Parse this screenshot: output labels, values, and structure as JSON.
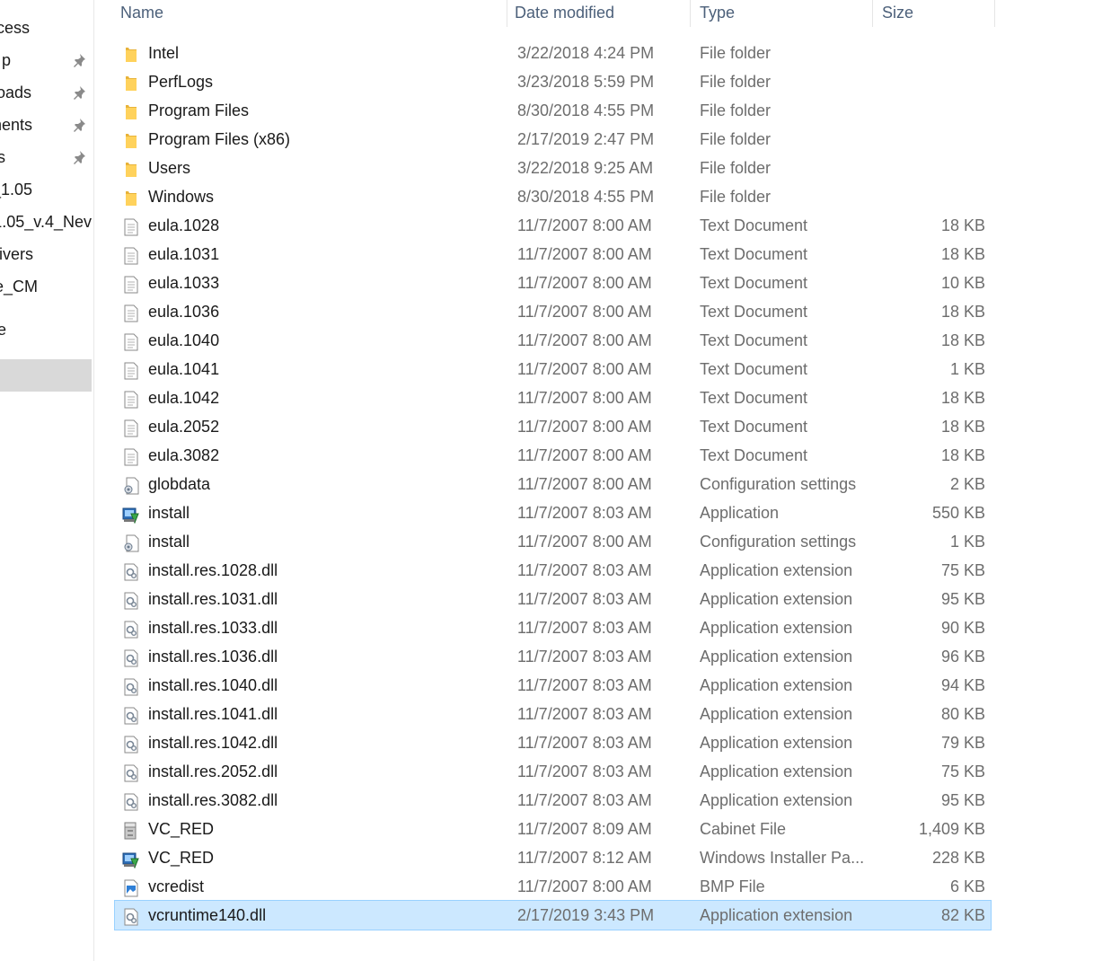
{
  "nav": {
    "items": [
      {
        "label": "cess",
        "pinned": false,
        "selected": false
      },
      {
        "label": "p",
        "pinned": true,
        "selected": false
      },
      {
        "label": "oads",
        "pinned": true,
        "selected": false
      },
      {
        "label": "nents",
        "pinned": true,
        "selected": false
      },
      {
        "label": "s",
        "pinned": true,
        "selected": false
      },
      {
        "label": "_1.05",
        "pinned": false,
        "selected": false
      },
      {
        "label": "_1.05_v.4_Nev",
        "pinned": false,
        "selected": false
      },
      {
        "label": "ivers",
        "pinned": false,
        "selected": false
      },
      {
        "label": "e_CM",
        "pinned": false,
        "selected": false
      },
      {
        "label": "e",
        "pinned": false,
        "selected": false
      },
      {
        "label": "",
        "pinned": false,
        "selected": true
      }
    ]
  },
  "columns": {
    "name": "Name",
    "date": "Date modified",
    "type": "Type",
    "size": "Size"
  },
  "files": [
    {
      "name": "Intel",
      "date": "3/22/2018 4:24 PM",
      "type": "File folder",
      "size": "",
      "icon": "folder-icon"
    },
    {
      "name": "PerfLogs",
      "date": "3/23/2018 5:59 PM",
      "type": "File folder",
      "size": "",
      "icon": "folder-icon"
    },
    {
      "name": "Program Files",
      "date": "8/30/2018 4:55 PM",
      "type": "File folder",
      "size": "",
      "icon": "folder-icon"
    },
    {
      "name": "Program Files (x86)",
      "date": "2/17/2019 2:47 PM",
      "type": "File folder",
      "size": "",
      "icon": "folder-icon"
    },
    {
      "name": "Users",
      "date": "3/22/2018 9:25 AM",
      "type": "File folder",
      "size": "",
      "icon": "folder-icon"
    },
    {
      "name": "Windows",
      "date": "8/30/2018 4:55 PM",
      "type": "File folder",
      "size": "",
      "icon": "folder-icon"
    },
    {
      "name": "eula.1028",
      "date": "11/7/2007 8:00 AM",
      "type": "Text Document",
      "size": "18 KB",
      "icon": "text-document-icon"
    },
    {
      "name": "eula.1031",
      "date": "11/7/2007 8:00 AM",
      "type": "Text Document",
      "size": "18 KB",
      "icon": "text-document-icon"
    },
    {
      "name": "eula.1033",
      "date": "11/7/2007 8:00 AM",
      "type": "Text Document",
      "size": "10 KB",
      "icon": "text-document-icon"
    },
    {
      "name": "eula.1036",
      "date": "11/7/2007 8:00 AM",
      "type": "Text Document",
      "size": "18 KB",
      "icon": "text-document-icon"
    },
    {
      "name": "eula.1040",
      "date": "11/7/2007 8:00 AM",
      "type": "Text Document",
      "size": "18 KB",
      "icon": "text-document-icon"
    },
    {
      "name": "eula.1041",
      "date": "11/7/2007 8:00 AM",
      "type": "Text Document",
      "size": "1 KB",
      "icon": "text-document-icon"
    },
    {
      "name": "eula.1042",
      "date": "11/7/2007 8:00 AM",
      "type": "Text Document",
      "size": "18 KB",
      "icon": "text-document-icon"
    },
    {
      "name": "eula.2052",
      "date": "11/7/2007 8:00 AM",
      "type": "Text Document",
      "size": "18 KB",
      "icon": "text-document-icon"
    },
    {
      "name": "eula.3082",
      "date": "11/7/2007 8:00 AM",
      "type": "Text Document",
      "size": "18 KB",
      "icon": "text-document-icon"
    },
    {
      "name": "globdata",
      "date": "11/7/2007 8:00 AM",
      "type": "Configuration settings",
      "size": "2 KB",
      "icon": "config-settings-icon"
    },
    {
      "name": "install",
      "date": "11/7/2007 8:03 AM",
      "type": "Application",
      "size": "550 KB",
      "icon": "installer-application-icon"
    },
    {
      "name": "install",
      "date": "11/7/2007 8:00 AM",
      "type": "Configuration settings",
      "size": "1 KB",
      "icon": "config-settings-icon"
    },
    {
      "name": "install.res.1028.dll",
      "date": "11/7/2007 8:03 AM",
      "type": "Application extension",
      "size": "75 KB",
      "icon": "dll-file-icon"
    },
    {
      "name": "install.res.1031.dll",
      "date": "11/7/2007 8:03 AM",
      "type": "Application extension",
      "size": "95 KB",
      "icon": "dll-file-icon"
    },
    {
      "name": "install.res.1033.dll",
      "date": "11/7/2007 8:03 AM",
      "type": "Application extension",
      "size": "90 KB",
      "icon": "dll-file-icon"
    },
    {
      "name": "install.res.1036.dll",
      "date": "11/7/2007 8:03 AM",
      "type": "Application extension",
      "size": "96 KB",
      "icon": "dll-file-icon"
    },
    {
      "name": "install.res.1040.dll",
      "date": "11/7/2007 8:03 AM",
      "type": "Application extension",
      "size": "94 KB",
      "icon": "dll-file-icon"
    },
    {
      "name": "install.res.1041.dll",
      "date": "11/7/2007 8:03 AM",
      "type": "Application extension",
      "size": "80 KB",
      "icon": "dll-file-icon"
    },
    {
      "name": "install.res.1042.dll",
      "date": "11/7/2007 8:03 AM",
      "type": "Application extension",
      "size": "79 KB",
      "icon": "dll-file-icon"
    },
    {
      "name": "install.res.2052.dll",
      "date": "11/7/2007 8:03 AM",
      "type": "Application extension",
      "size": "75 KB",
      "icon": "dll-file-icon"
    },
    {
      "name": "install.res.3082.dll",
      "date": "11/7/2007 8:03 AM",
      "type": "Application extension",
      "size": "95 KB",
      "icon": "dll-file-icon"
    },
    {
      "name": "VC_RED",
      "date": "11/7/2007 8:09 AM",
      "type": "Cabinet File",
      "size": "1,409 KB",
      "icon": "cabinet-file-icon"
    },
    {
      "name": "VC_RED",
      "date": "11/7/2007 8:12 AM",
      "type": "Windows Installer Pa...",
      "size": "228 KB",
      "icon": "installer-package-icon"
    },
    {
      "name": "vcredist",
      "date": "11/7/2007 8:00 AM",
      "type": "BMP File",
      "size": "6 KB",
      "icon": "bmp-image-icon"
    },
    {
      "name": "vcruntime140.dll",
      "date": "2/17/2019 3:43 PM",
      "type": "Application extension",
      "size": "82 KB",
      "icon": "dll-file-icon",
      "selected": true
    }
  ]
}
